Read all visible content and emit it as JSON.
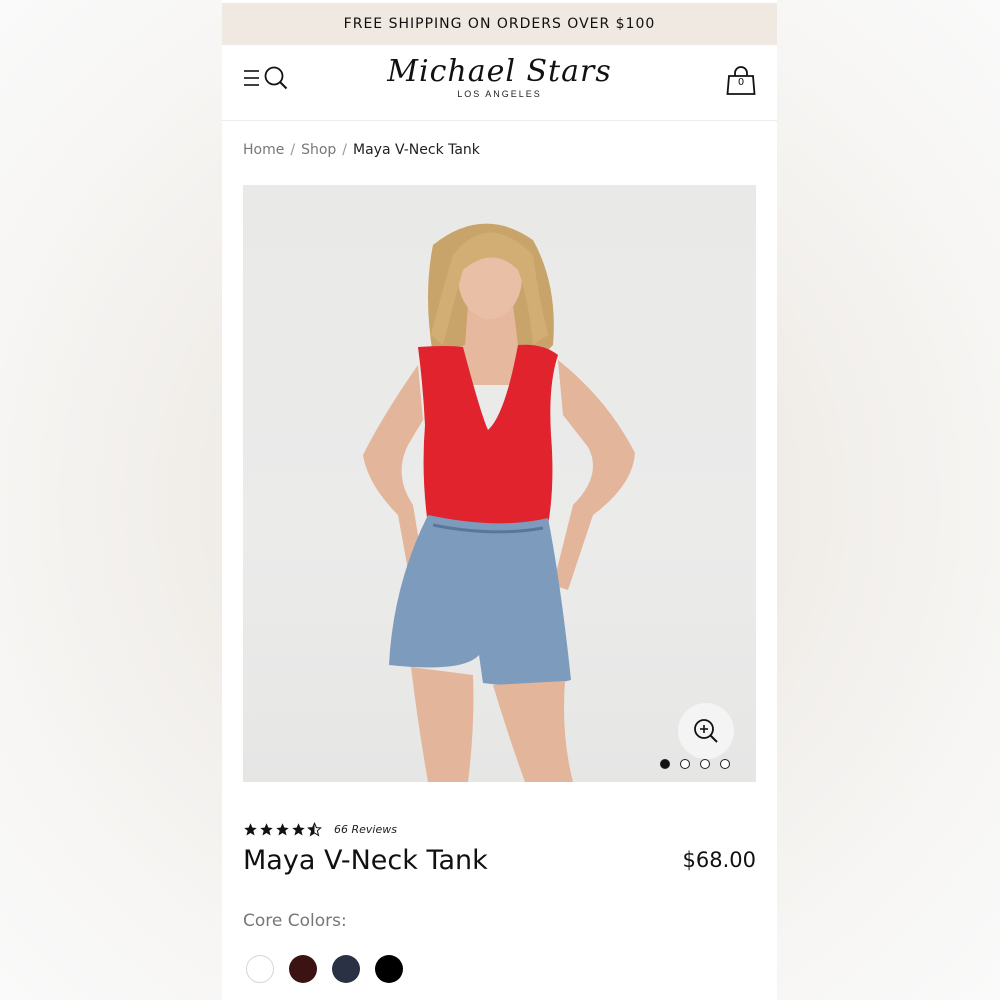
{
  "promo": {
    "text": "FREE SHIPPING ON ORDERS OVER $100"
  },
  "header": {
    "logo_script": "Michael Stars",
    "logo_sub": "LOS ANGELES",
    "cart_count": "0",
    "menu_icon": "hamburger-icon",
    "search_icon": "search-icon",
    "cart_icon": "shopping-bag-icon"
  },
  "breadcrumb": {
    "items": [
      "Home",
      "Shop",
      "Maya V-Neck Tank"
    ],
    "separator": "/"
  },
  "gallery": {
    "image_count": 4,
    "active_index": 0,
    "zoom_icon": "zoom-in-icon"
  },
  "product": {
    "rating": 4.5,
    "reviews": "66 Reviews",
    "title": "Maya V-Neck Tank",
    "price": "$68.00"
  },
  "colors": {
    "label": "Core Colors:",
    "swatches": [
      "#ffffff",
      "#3b1313",
      "#2b3145",
      "#000000"
    ]
  }
}
